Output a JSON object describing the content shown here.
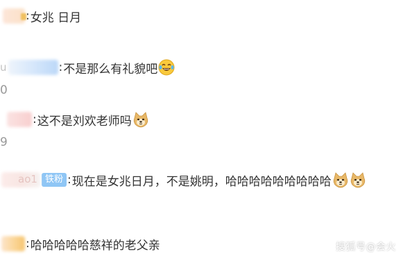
{
  "comments": [
    {
      "user": "",
      "text": "女兆 日月",
      "meta": ""
    },
    {
      "user": "u",
      "text": "不是那么有礼貌吧",
      "emoji": "laughing-tears-emoji",
      "meta": "0"
    },
    {
      "user": "",
      "text": "这不是刘欢老师吗",
      "emoji": "doge-emoji",
      "meta": "9"
    },
    {
      "user": "ao1",
      "badge": "铁粉",
      "text": "现在是女兆日月，不是姚明，哈哈哈哈哈哈哈哈哈",
      "emoji": "doge-emoji",
      "meta": ""
    },
    {
      "user": "",
      "text": "哈哈哈哈哈慈祥的老父亲",
      "meta": ""
    }
  ],
  "colon": ":",
  "watermark": "搜狐号@会火",
  "colors": {
    "text": "#333333",
    "meta": "#999999",
    "badge_bg": "#8fc6f5",
    "badge_text": "#ffffff"
  }
}
